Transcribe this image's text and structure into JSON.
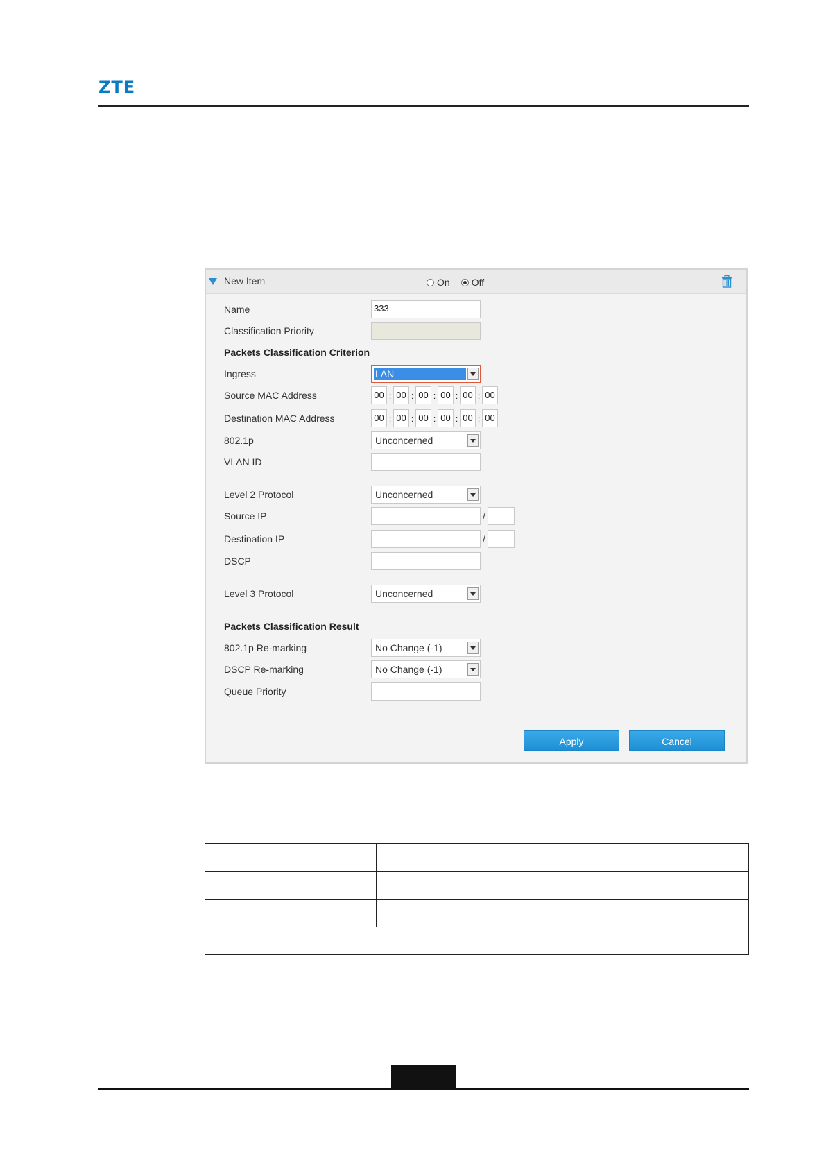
{
  "header": {
    "logo": "ZTE"
  },
  "panel": {
    "title": "New Item",
    "toggle": {
      "on_label": "On",
      "off_label": "Off",
      "selected": "Off"
    },
    "fields": {
      "name": {
        "label": "Name",
        "value": "333"
      },
      "classification_priority": {
        "label": "Classification Priority",
        "value": ""
      },
      "criterion_heading": "Packets Classification Criterion",
      "ingress": {
        "label": "Ingress",
        "value": "LAN"
      },
      "source_mac": {
        "label": "Source MAC Address",
        "octets": [
          "00",
          "00",
          "00",
          "00",
          "00",
          "00"
        ]
      },
      "dest_mac": {
        "label": "Destination MAC Address",
        "octets": [
          "00",
          "00",
          "00",
          "00",
          "00",
          "00"
        ]
      },
      "dot1p": {
        "label": "802.1p",
        "value": "Unconcerned"
      },
      "vlan_id": {
        "label": "VLAN ID",
        "value": ""
      },
      "level2_protocol": {
        "label": "Level 2 Protocol",
        "value": "Unconcerned"
      },
      "source_ip": {
        "label": "Source IP",
        "value": "",
        "mask": "",
        "separator": "/"
      },
      "dest_ip": {
        "label": "Destination IP",
        "value": "",
        "mask": "",
        "separator": "/"
      },
      "dscp": {
        "label": "DSCP",
        "value": ""
      },
      "level3_protocol": {
        "label": "Level 3 Protocol",
        "value": "Unconcerned"
      },
      "result_heading": "Packets Classification Result",
      "dot1p_remark": {
        "label": "802.1p Re-marking",
        "value": "No Change (-1)"
      },
      "dscp_remark": {
        "label": "DSCP Re-marking",
        "value": "No Change (-1)"
      },
      "queue_priority": {
        "label": "Queue Priority",
        "value": ""
      }
    },
    "buttons": {
      "apply": "Apply",
      "cancel": "Cancel"
    }
  },
  "mac_separator": ":"
}
